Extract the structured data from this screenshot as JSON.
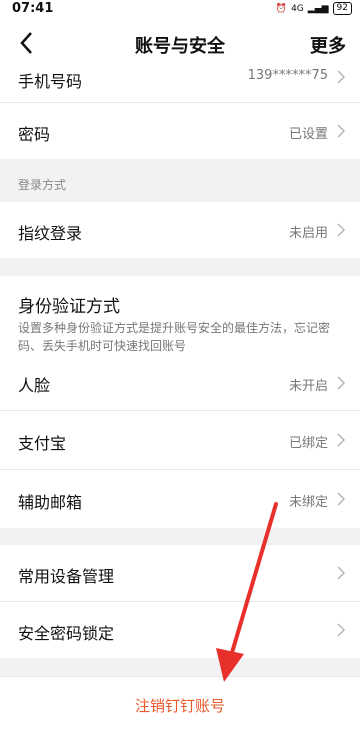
{
  "status_bar": {
    "time": "07:41",
    "network": "4G",
    "battery": "92"
  },
  "header": {
    "title": "账号与安全",
    "more": "更多"
  },
  "rows": {
    "phone": {
      "label": "手机号码",
      "value": "139******75"
    },
    "password": {
      "label": "密码",
      "value": "已设置"
    },
    "fingerprint": {
      "label": "指纹登录",
      "value": "未启用"
    },
    "face": {
      "label": "人脸",
      "value": "未开启"
    },
    "alipay": {
      "label": "支付宝",
      "value": "已绑定"
    },
    "email": {
      "label": "辅助邮箱",
      "value": "未绑定"
    },
    "devices": {
      "label": "常用设备管理"
    },
    "lock": {
      "label": "安全密码锁定"
    }
  },
  "sections": {
    "login_method": "登录方式",
    "identity_title": "身份验证方式",
    "identity_desc": "设置多种身份验证方式是提升账号安全的最佳方法，忘记密码、丢失手机时可快速找回账号"
  },
  "cancel_account": "注销钉钉账号",
  "colors": {
    "danger": "#e85a2a",
    "annotation_arrow": "#e8302b"
  }
}
